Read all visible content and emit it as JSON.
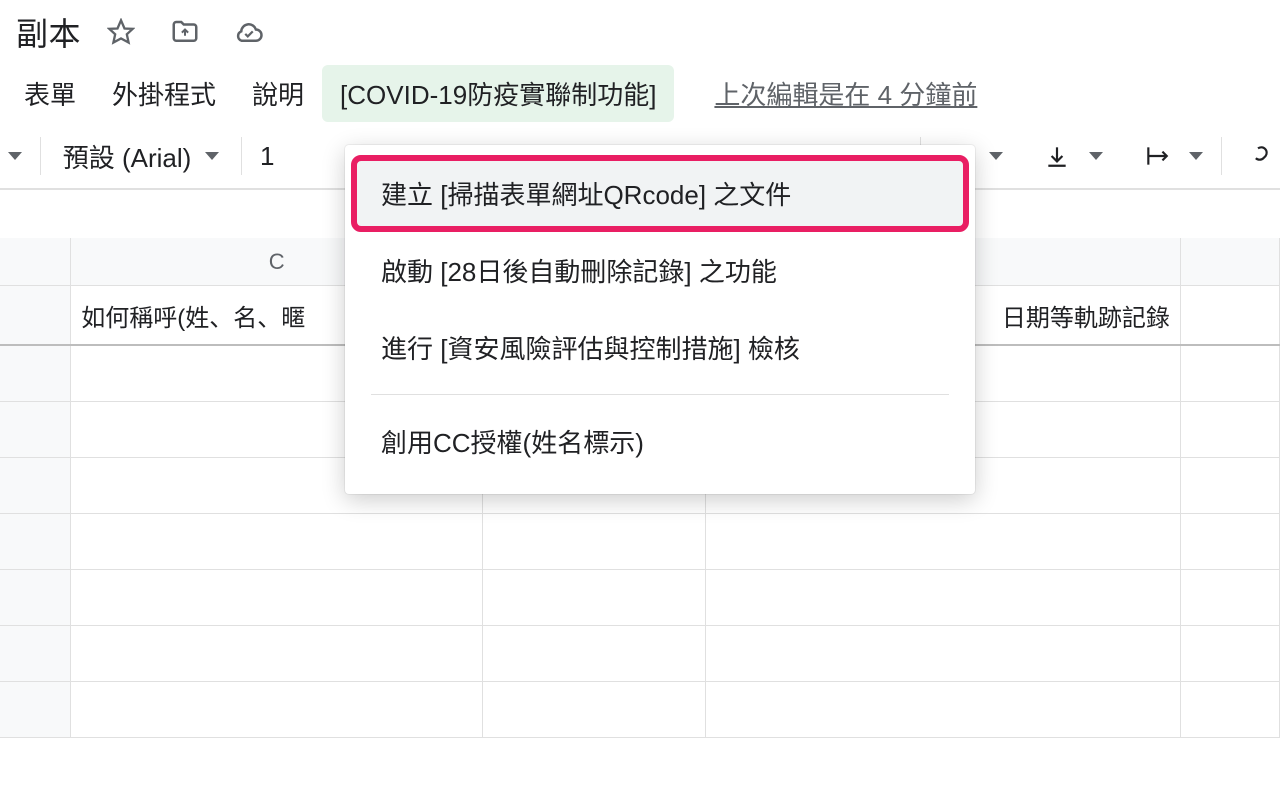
{
  "title": "副本",
  "menubar": {
    "form": "表單",
    "extensions": "外掛程式",
    "help": "說明",
    "covid_addon": "[COVID-19防疫實聯制功能]"
  },
  "last_edit": "上次編輯是在 4 分鐘前",
  "toolbar": {
    "font": "預設 (Arial)",
    "size": "1"
  },
  "columns": {
    "c": "C"
  },
  "headers": {
    "col_c": "如何稱呼(姓、名、暱",
    "col_right": "日期等軌跡記錄"
  },
  "dropdown": {
    "item1": "建立 [掃描表單網址QRcode] 之文件",
    "item2": "啟動 [28日後自動刪除記錄] 之功能",
    "item3": "進行 [資安風險評估與控制措施] 檢核",
    "item4": "創用CC授權(姓名標示)"
  }
}
